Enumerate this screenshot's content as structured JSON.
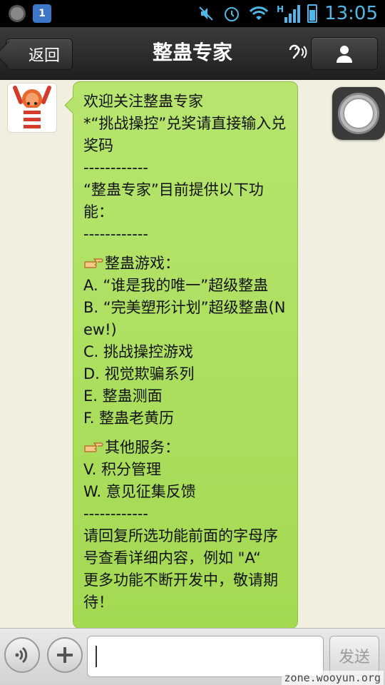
{
  "status_bar": {
    "app_badge": "1",
    "network_type": "H",
    "time": "13:05"
  },
  "header": {
    "back_label": "返回",
    "title": "整蛊专家"
  },
  "message": {
    "lines": [
      {
        "text": "欢迎关注整蛊专家"
      },
      {
        "text": "*“挑战操控”兑奖请直接输入兑奖码"
      },
      {
        "text": "------------"
      },
      {
        "text": "“整蛊专家”目前提供以下功能："
      },
      {
        "text": "------------"
      },
      {
        "gap": true
      },
      {
        "hand": true,
        "text": "整蛊游戏："
      },
      {
        "text": "A. “谁是我的唯一”超级整蛊"
      },
      {
        "text": "B. “完美塑形计划”超级整蛊(New!)"
      },
      {
        "text": "C. 挑战操控游戏"
      },
      {
        "text": "D. 视觉欺骗系列"
      },
      {
        "text": "E. 整蛊测面"
      },
      {
        "text": "F. 整蛊老黄历"
      },
      {
        "gap": true
      },
      {
        "hand": true,
        "text": "其他服务："
      },
      {
        "text": "V. 积分管理"
      },
      {
        "text": "W. 意见征集反馈"
      },
      {
        "text": "------------"
      },
      {
        "text": "请回复所选功能前面的字母序号查看详细内容，例如 \"A“"
      },
      {
        "text": "更多功能不断开发中，敬请期待！"
      }
    ]
  },
  "input_bar": {
    "input_value": "",
    "send_label": "发送"
  },
  "watermark": "zone.wooyun.org",
  "colors": {
    "bubble": "#a4d952",
    "background": "#f1efe0",
    "statusbar_accent": "#4fb8e8"
  }
}
